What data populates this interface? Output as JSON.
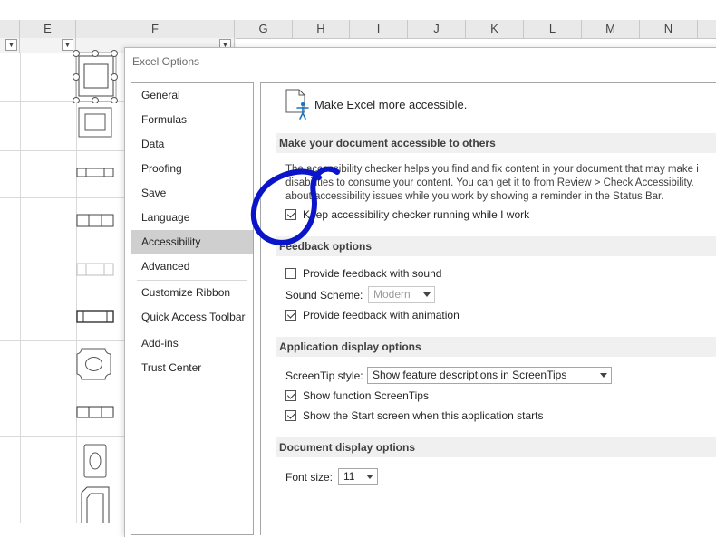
{
  "sheet": {
    "columns": [
      "E",
      "F",
      "G",
      "H",
      "I",
      "J",
      "K",
      "L",
      "M",
      "N"
    ]
  },
  "dialog": {
    "title": "Excel Options",
    "nav": [
      {
        "label": "General",
        "selected": false
      },
      {
        "label": "Formulas",
        "selected": false
      },
      {
        "label": "Data",
        "selected": false
      },
      {
        "label": "Proofing",
        "selected": false
      },
      {
        "label": "Save",
        "selected": false
      },
      {
        "label": "Language",
        "selected": false
      },
      {
        "label": "Accessibility",
        "selected": true
      },
      {
        "label": "Advanced",
        "selected": false
      },
      {
        "label": "Customize Ribbon",
        "selected": false
      },
      {
        "label": "Quick Access Toolbar",
        "selected": false
      },
      {
        "label": "Add-ins",
        "selected": false
      },
      {
        "label": "Trust Center",
        "selected": false
      }
    ],
    "header": {
      "icon": "accessibility-document-icon",
      "text": "Make Excel more accessible."
    },
    "sections": {
      "accessible": {
        "heading": "Make your document accessible to others",
        "paragraph": [
          "The accessibility checker helps you find and fix content in your document that may make i",
          "disabilities to consume your content. You can get it to from Review > Check Accessibility.",
          "about accessibility issues while you work by showing a reminder in the Status Bar."
        ],
        "keep_checker": {
          "label": "Keep accessibility checker running while I work",
          "checked": true
        }
      },
      "feedback": {
        "heading": "Feedback options",
        "provide_sound": {
          "label": "Provide feedback with sound",
          "checked": false
        },
        "sound_scheme_label": "Sound Scheme:",
        "sound_scheme_value": "Modern",
        "provide_animation": {
          "label": "Provide feedback with animation",
          "checked": true
        }
      },
      "app_display": {
        "heading": "Application display options",
        "screentip_label": "ScreenTip style:",
        "screentip_value": "Show feature descriptions in ScreenTips",
        "show_function": {
          "label": "Show function ScreenTips",
          "checked": true
        },
        "show_start": {
          "label": "Show the Start screen when this application starts",
          "checked": true
        }
      },
      "doc_display": {
        "heading": "Document display options",
        "font_size_label": "Font size:",
        "font_size_value": "11"
      }
    }
  },
  "colors": {
    "annotation": "#0a14c8",
    "nav_selected": "#cfcfcf",
    "section_bg": "#f0f0f0",
    "icon_accent": "#1a73c4"
  }
}
